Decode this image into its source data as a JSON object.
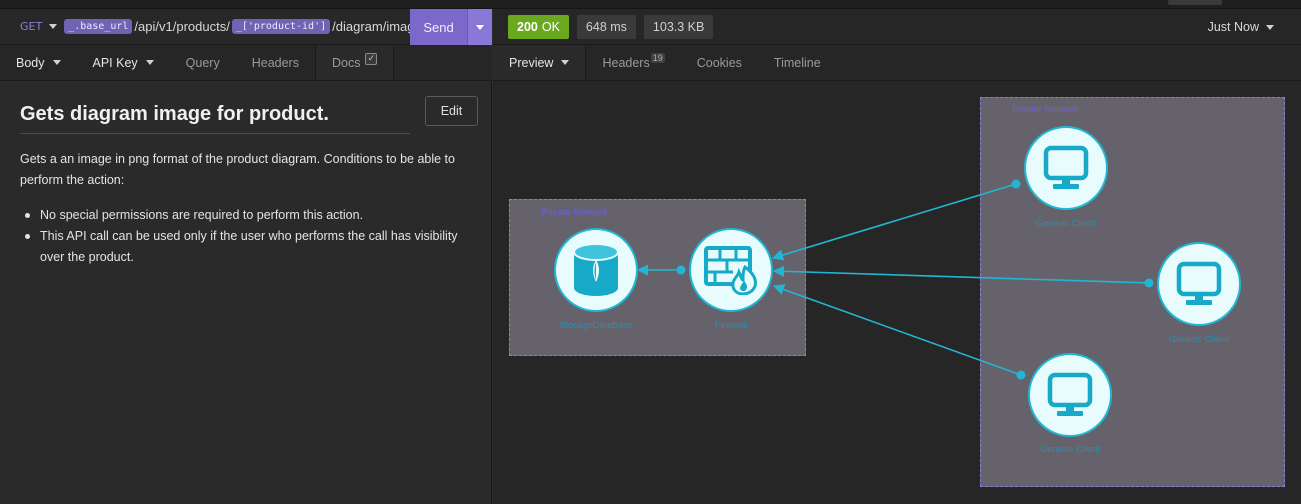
{
  "request": {
    "method": "GET",
    "url_var_1": "_.base_url",
    "url_path_1": "/api/v1/products/",
    "url_var_2": "_['product-id']",
    "url_path_2": "/diagram/imag",
    "send_label": "Send"
  },
  "request_tabs": [
    {
      "label": "Body"
    },
    {
      "label": "API Key"
    },
    {
      "label": "Query"
    },
    {
      "label": "Headers"
    },
    {
      "label": "Docs"
    }
  ],
  "docs": {
    "title": "Gets diagram image for product.",
    "edit_label": "Edit",
    "description": "Gets a an image in png format of the product diagram. Conditions to be able to perform the action:",
    "bullets": [
      "No special permissions are required to perform this action.",
      "This API call can be used only if the user who performs the call has visibility over the product."
    ]
  },
  "response": {
    "status_code": "200",
    "status_text": "OK",
    "time": "648 ms",
    "size": "103.3 KB",
    "history": "Just Now"
  },
  "response_tabs": [
    {
      "label": "Preview"
    },
    {
      "label": "Headers",
      "count": "19"
    },
    {
      "label": "Cookies"
    },
    {
      "label": "Timeline"
    }
  ],
  "diagram": {
    "cluster_left_label": "Private Network",
    "cluster_right_label": "Private Network",
    "nodes": {
      "database": "StorageDatabase",
      "firewall": "Firewall",
      "client_top": "Generic Client",
      "client_mid": "Generic Client",
      "client_bottom": "Generic Client"
    },
    "colors": {
      "edge": "#21b7d3",
      "icon": "#17aac8",
      "cluster_fill": "#65626b",
      "cluster_border": "#8a7fd6"
    }
  }
}
